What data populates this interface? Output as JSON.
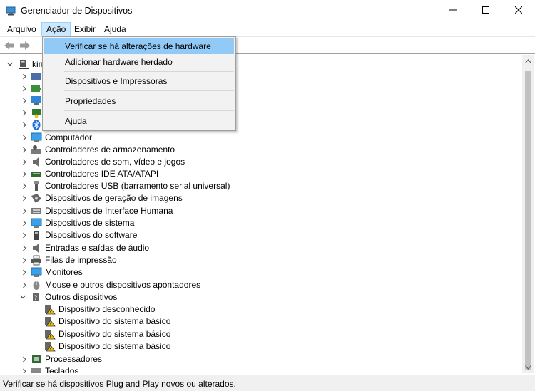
{
  "window": {
    "title": "Gerenciador de Dispositivos",
    "app_icon": "device-manager-icon",
    "controls": [
      "minimize-icon",
      "maximize-icon",
      "close-icon"
    ]
  },
  "menubar": {
    "items": [
      {
        "label": "Arquivo"
      },
      {
        "label": "Ação"
      },
      {
        "label": "Exibir"
      },
      {
        "label": "Ajuda"
      }
    ]
  },
  "toolbar": {
    "buttons": [
      "back-arrow-icon",
      "forward-arrow-icon"
    ]
  },
  "dropdown": {
    "items": [
      {
        "label": "Verificar se há alterações de hardware"
      },
      {
        "label": "Adicionar hardware herdado"
      },
      {
        "label": "Dispositivos e Impressoras"
      },
      {
        "label": "Propriedades"
      },
      {
        "label": "Ajuda"
      }
    ]
  },
  "tree": {
    "root_label": "kin",
    "categories": [
      {
        "label": "",
        "icon": "audio-inputs-icon"
      },
      {
        "label": "",
        "icon": "batteries-icon"
      },
      {
        "label": "",
        "icon": "monitor-icon"
      },
      {
        "label": "",
        "icon": "network-icon"
      },
      {
        "label": "",
        "icon": "bluetooth-icon"
      },
      {
        "label": "Computador",
        "icon": "computer-icon"
      },
      {
        "label": "Controladores de armazenamento",
        "icon": "storage-icon"
      },
      {
        "label": "Controladores de som, vídeo e jogos",
        "icon": "speaker-icon"
      },
      {
        "label": "Controladores IDE ATA/ATAPI",
        "icon": "ide-icon"
      },
      {
        "label": "Controladores USB (barramento serial universal)",
        "icon": "usb-icon"
      },
      {
        "label": "Dispositivos de geração de imagens",
        "icon": "camera-icon"
      },
      {
        "label": "Dispositivos de Interface Humana",
        "icon": "hid-icon"
      },
      {
        "label": "Dispositivos de sistema",
        "icon": "system-icon"
      },
      {
        "label": "Dispositivos do software",
        "icon": "software-icon"
      },
      {
        "label": "Entradas e saídas de áudio",
        "icon": "audio-icon"
      },
      {
        "label": "Filas de impressão",
        "icon": "printer-icon"
      },
      {
        "label": "Monitores",
        "icon": "monitor-icon"
      },
      {
        "label": "Mouse e outros dispositivos apontadores",
        "icon": "mouse-icon"
      },
      {
        "label": "Outros dispositivos",
        "icon": "other-devices-icon",
        "expanded": true
      }
    ],
    "children": [
      {
        "label": "Dispositivo desconhecido",
        "icon": "warning-device-icon"
      },
      {
        "label": "Dispositivo do sistema básico",
        "icon": "warning-device-icon"
      },
      {
        "label": "Dispositivo do sistema básico",
        "icon": "warning-device-icon"
      },
      {
        "label": "Dispositivo do sistema básico",
        "icon": "warning-device-icon"
      }
    ],
    "after": [
      {
        "label": "Processadores",
        "icon": "processor-icon"
      },
      {
        "label": "Teclados",
        "icon": "keyboard-icon"
      }
    ]
  },
  "statusbar": {
    "text": "Verificar se há dispositivos Plug and Play novos ou alterados."
  },
  "colors": {
    "menu_active_bg": "#cce8ff",
    "dropdown_highlight": "#91c9f7",
    "dropdown_bg": "#f2f2f2"
  }
}
